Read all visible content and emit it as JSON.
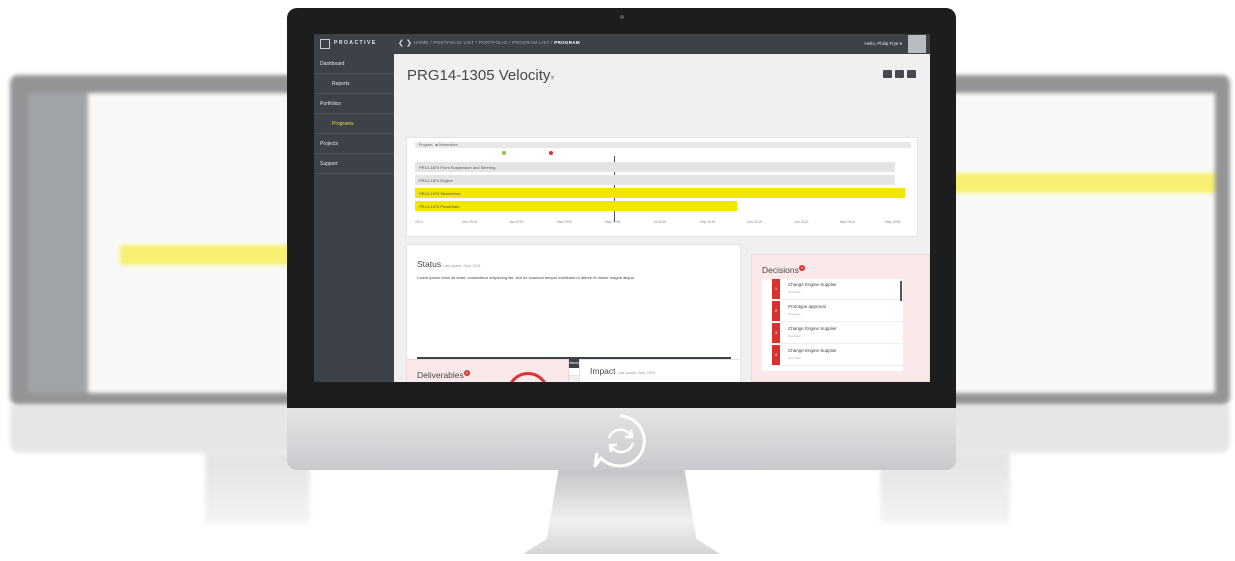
{
  "app": {
    "brand": "PROACTIVE",
    "breadcrumb": [
      "HOME",
      "PORTFOLIO LIST",
      "PORTFOLIO",
      "PROGRAM LIST"
    ],
    "breadcrumb_current": "PROGRAM",
    "user_greeting": "Hello, Philip Frye"
  },
  "sidebar": {
    "items": [
      {
        "label": "Dashboard"
      },
      {
        "label": "Reports"
      },
      {
        "label": "Portfolios"
      },
      {
        "label": "Programs"
      },
      {
        "label": "Projects"
      },
      {
        "label": "Support"
      }
    ]
  },
  "page": {
    "title": "PRG14-1305 Velocity",
    "title_caret": "▾"
  },
  "gantt": {
    "legend": [
      "Program",
      "Deliverables"
    ],
    "rows": [
      {
        "label": "PR14-1873 Front Suspension and Steering",
        "highlight": false
      },
      {
        "label": "PR14-1874 Engine",
        "highlight": false
      },
      {
        "label": "PR14-1875 Streamliner",
        "highlight": true
      },
      {
        "label": "PR14-1876 Powertrain",
        "highlight": true
      }
    ],
    "axis": [
      "2014",
      "Nov 2014",
      "Jan 2015",
      "Mar 2015",
      "May 2015",
      "Jul 2015",
      "Sep 2015",
      "Nov 2015",
      "Jan 2016",
      "Mar 2016",
      "May 2016"
    ],
    "colors": {
      "highlight": "#f2e500",
      "milestone_green": "#8bc34a",
      "milestone_red": "#d9322e"
    }
  },
  "status": {
    "title": "Status",
    "meta": "Last update: Sept. 2015",
    "text": "Lorem ipsum dolor sit amet, consectetur adipiscing elit, sed do eiusmod tempor incididunt ut labore et dolore magna aliqua.",
    "history_label": "History"
  },
  "decisions": {
    "title": "Decisions",
    "badge": "4",
    "items": [
      {
        "num": "1",
        "label": "Change Engine Supplier",
        "meta": "Due Date"
      },
      {
        "num": "2",
        "label": "Prototype approval",
        "meta": "Due Date"
      },
      {
        "num": "3",
        "label": "Change Engine Supplier",
        "meta": "Due Date"
      },
      {
        "num": "4",
        "label": "Change Engine Supplier",
        "meta": "Due Date"
      }
    ]
  },
  "deliverables": {
    "title": "Deliverables",
    "badge": "4"
  },
  "impact": {
    "title": "Impact",
    "meta": "Last update: Sept. 2015"
  },
  "icons": [
    "sync-icon",
    "back-arrow-icon",
    "forward-arrow-icon",
    "avatar-icon"
  ]
}
